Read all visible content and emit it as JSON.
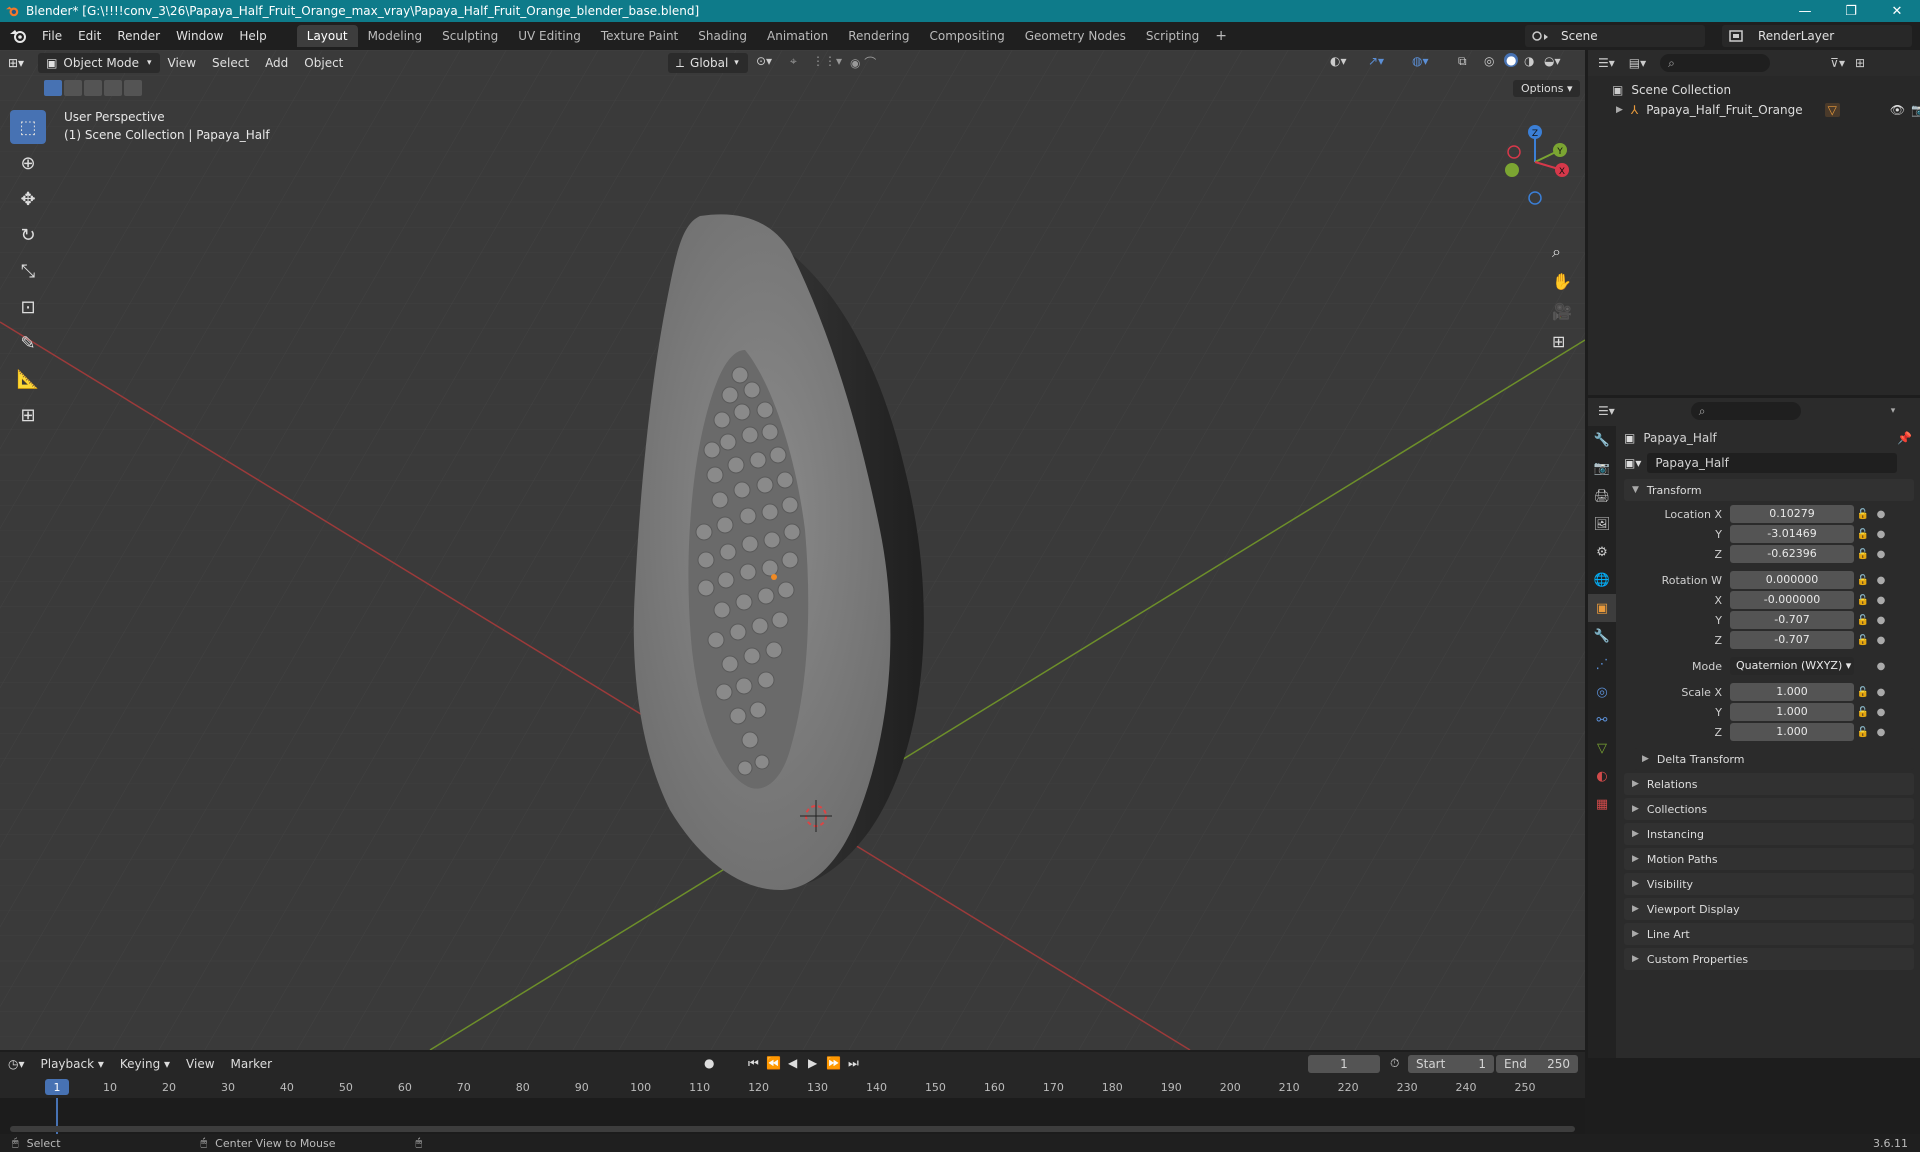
{
  "titlebar": {
    "title": "Blender* [G:\\!!!!conv_3\\26\\Papaya_Half_Fruit_Orange_max_vray\\Papaya_Half_Fruit_Orange_blender_base.blend]",
    "minimize": "—",
    "maximize": "❐",
    "close": "✕"
  },
  "menu": [
    "File",
    "Edit",
    "Render",
    "Window",
    "Help"
  ],
  "workspaces": [
    "Layout",
    "Modeling",
    "Sculpting",
    "UV Editing",
    "Texture Paint",
    "Shading",
    "Animation",
    "Rendering",
    "Compositing",
    "Geometry Nodes",
    "Scripting"
  ],
  "active_workspace": "Layout",
  "scene": "Scene",
  "view_layer": "RenderLayer",
  "viewport": {
    "mode": "Object Mode",
    "menus": [
      "View",
      "Select",
      "Add",
      "Object"
    ],
    "orientation": "Global",
    "options": "Options",
    "perspective": "User Perspective",
    "collection_info": "(1) Scene Collection | Papaya_Half"
  },
  "gizmo": {
    "z": "Z",
    "y": "Y",
    "x": "X"
  },
  "outliner": {
    "root": "Scene Collection",
    "items": [
      {
        "label": "Papaya_Half_Fruit_Orange"
      }
    ]
  },
  "properties": {
    "object_name": "Papaya_Half",
    "datablock_name": "Papaya_Half",
    "transform_title": "Transform",
    "location": {
      "label_x": "Location X",
      "x": "0.10279",
      "y": "-3.01469",
      "z": "-0.62396"
    },
    "rotation": {
      "label_w": "Rotation W",
      "w": "0.000000",
      "x": "-0.000000",
      "y": "-0.707",
      "z": "-0.707"
    },
    "mode_label": "Mode",
    "mode": "Quaternion (WXYZ)",
    "scale": {
      "label_x": "Scale X",
      "x": "1.000",
      "y": "1.000",
      "z": "1.000"
    },
    "axis_y": "Y",
    "axis_z": "Z",
    "axis_x": "X",
    "delta": "Delta Transform",
    "panels": [
      "Relations",
      "Collections",
      "Instancing",
      "Motion Paths",
      "Visibility",
      "Viewport Display",
      "Line Art",
      "Custom Properties"
    ]
  },
  "timeline": {
    "menus": [
      "Playback",
      "Keying",
      "View",
      "Marker"
    ],
    "current_frame": "1",
    "start_label": "Start",
    "start": "1",
    "end_label": "End",
    "end": "250",
    "ruler": [
      "1",
      "10",
      "20",
      "30",
      "40",
      "50",
      "60",
      "70",
      "80",
      "90",
      "100",
      "110",
      "120",
      "130",
      "140",
      "150",
      "160",
      "170",
      "180",
      "190",
      "200",
      "210",
      "220",
      "230",
      "240",
      "250"
    ]
  },
  "status": {
    "select": "Select",
    "center": "Center View to Mouse",
    "version": "3.6.11"
  }
}
